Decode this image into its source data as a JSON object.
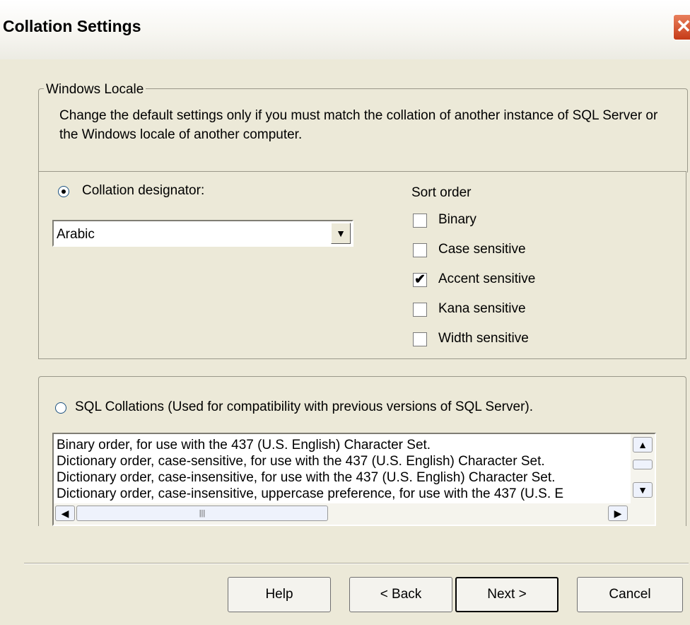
{
  "window": {
    "title": "Collation Settings",
    "close_glyph": "✕"
  },
  "windows_locale": {
    "legend": "Windows Locale",
    "description": "Change the default settings only if you must match the collation of another instance of SQL Server or the Windows locale of another computer."
  },
  "collation_designator": {
    "label": "Collation designator:",
    "selected": true,
    "dropdown_value": "Arabic",
    "dropdown_icon": "chevron-down-icon"
  },
  "sort_order": {
    "heading": "Sort order",
    "options": [
      {
        "label": "Binary",
        "checked": false
      },
      {
        "label": "Case sensitive",
        "checked": false
      },
      {
        "label": "Accent sensitive",
        "checked": true
      },
      {
        "label": "Kana sensitive",
        "checked": false
      },
      {
        "label": "Width sensitive",
        "checked": false
      }
    ]
  },
  "sql_collations": {
    "label": "SQL Collations (Used for compatibility with previous versions of SQL Server).",
    "selected": false,
    "items": [
      "Binary order, for use with the 437 (U.S. English) Character Set.",
      "Dictionary order, case-sensitive, for use with the 437 (U.S. English) Character Set.",
      "Dictionary order, case-insensitive, for use with the 437 (U.S. English) Character Set.",
      "Dictionary order, case-insensitive, uppercase preference, for use with the 437 (U.S. E"
    ]
  },
  "buttons": {
    "help": "Help",
    "back": "< Back",
    "next": "Next >",
    "cancel": "Cancel"
  },
  "colors": {
    "dialog_bg": "#ece9d8",
    "close_button": "#c53a17"
  }
}
